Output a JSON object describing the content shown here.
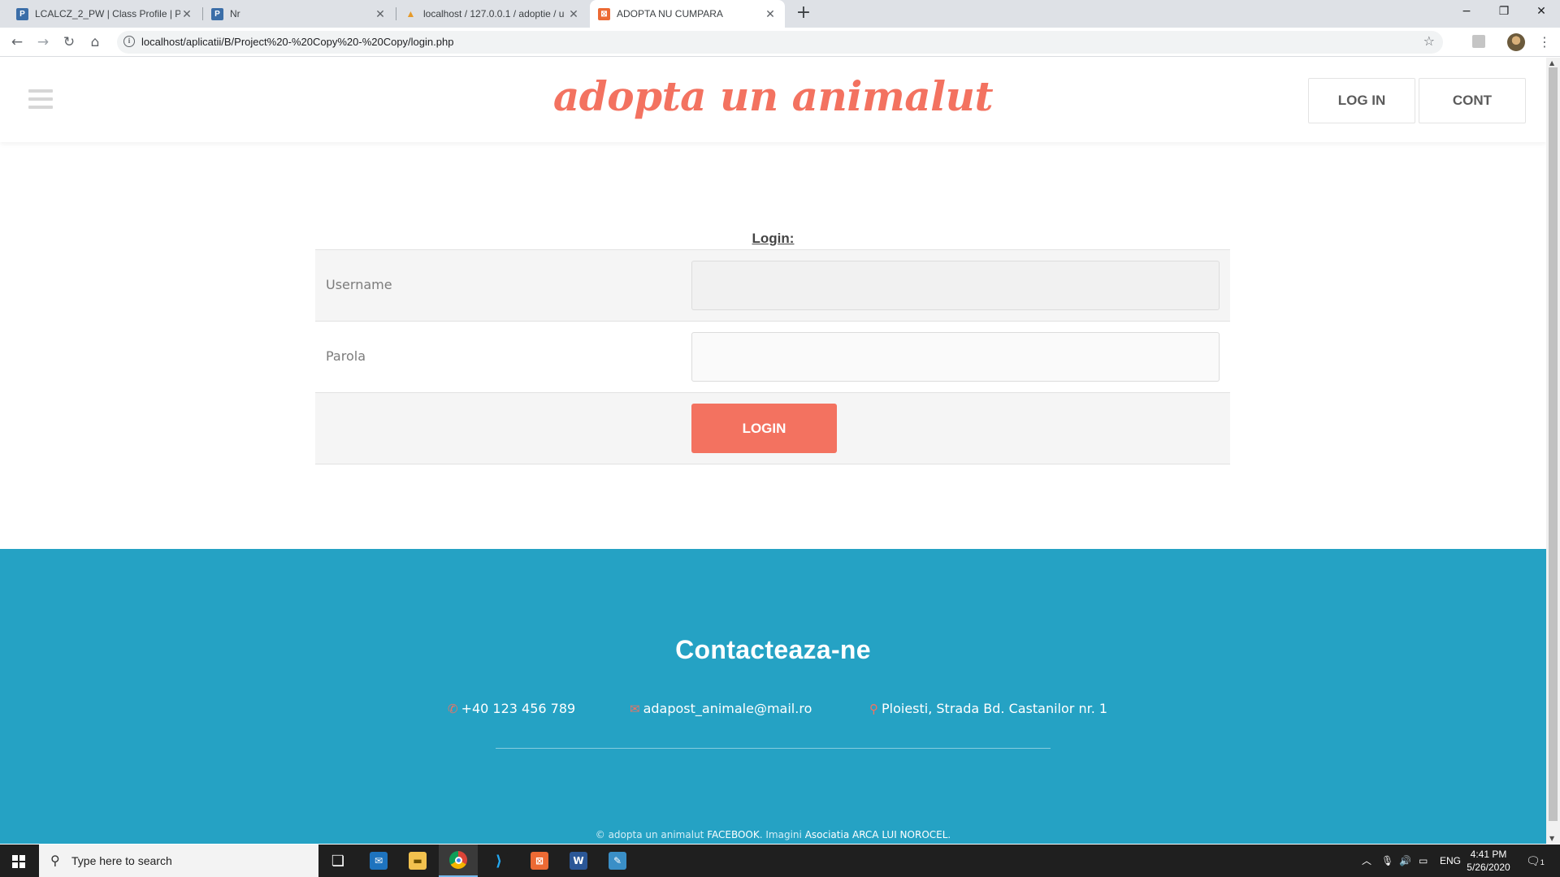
{
  "browser": {
    "tabs": [
      {
        "title": "LCALCZ_2_PW | Class Profile | Pi",
        "favicon": "p-icon",
        "color": "#3b6ea8"
      },
      {
        "title": "Nr",
        "favicon": "p-icon",
        "color": "#3b6ea8"
      },
      {
        "title": "localhost / 127.0.0.1 / adoptie / u",
        "favicon": "phpmyadmin-icon",
        "color": "#e69a2a"
      },
      {
        "title": "ADOPTA NU CUMPARA",
        "favicon": "xampp-icon",
        "color": "#ec6a34"
      }
    ],
    "url": "localhost/aplicatii/B/Project%20-%20Copy%20-%20Copy/login.php",
    "window_controls": {
      "minimize": "−",
      "restore": "❐",
      "close": "✕"
    }
  },
  "site": {
    "logo": "adopta un animalut",
    "nav": {
      "login": "LOG IN",
      "account": "CONT"
    },
    "colors": {
      "brand": "#f37260",
      "footer": "#25a2c4"
    }
  },
  "login": {
    "title": "Login:",
    "username_label": "Username",
    "password_label": "Parola",
    "submit": "LOGIN"
  },
  "footer": {
    "heading": "Contacteaza-ne",
    "phone": "+40 123 456 789",
    "email": "adapost_animale@mail.ro",
    "address": "Ploiesti, Strada Bd. Castanilor nr. 1",
    "copyright_prefix": "© adopta un animalut",
    "facebook": "FACEBOOK",
    "images_text": ". Imagini",
    "images_link": "Asociatia ARCA LUI NOROCEL",
    "suffix": "."
  },
  "taskbar": {
    "search_placeholder": "Type here to search",
    "language": "ENG",
    "time": "4:41 PM",
    "date": "5/26/2020",
    "notifications": "1"
  }
}
